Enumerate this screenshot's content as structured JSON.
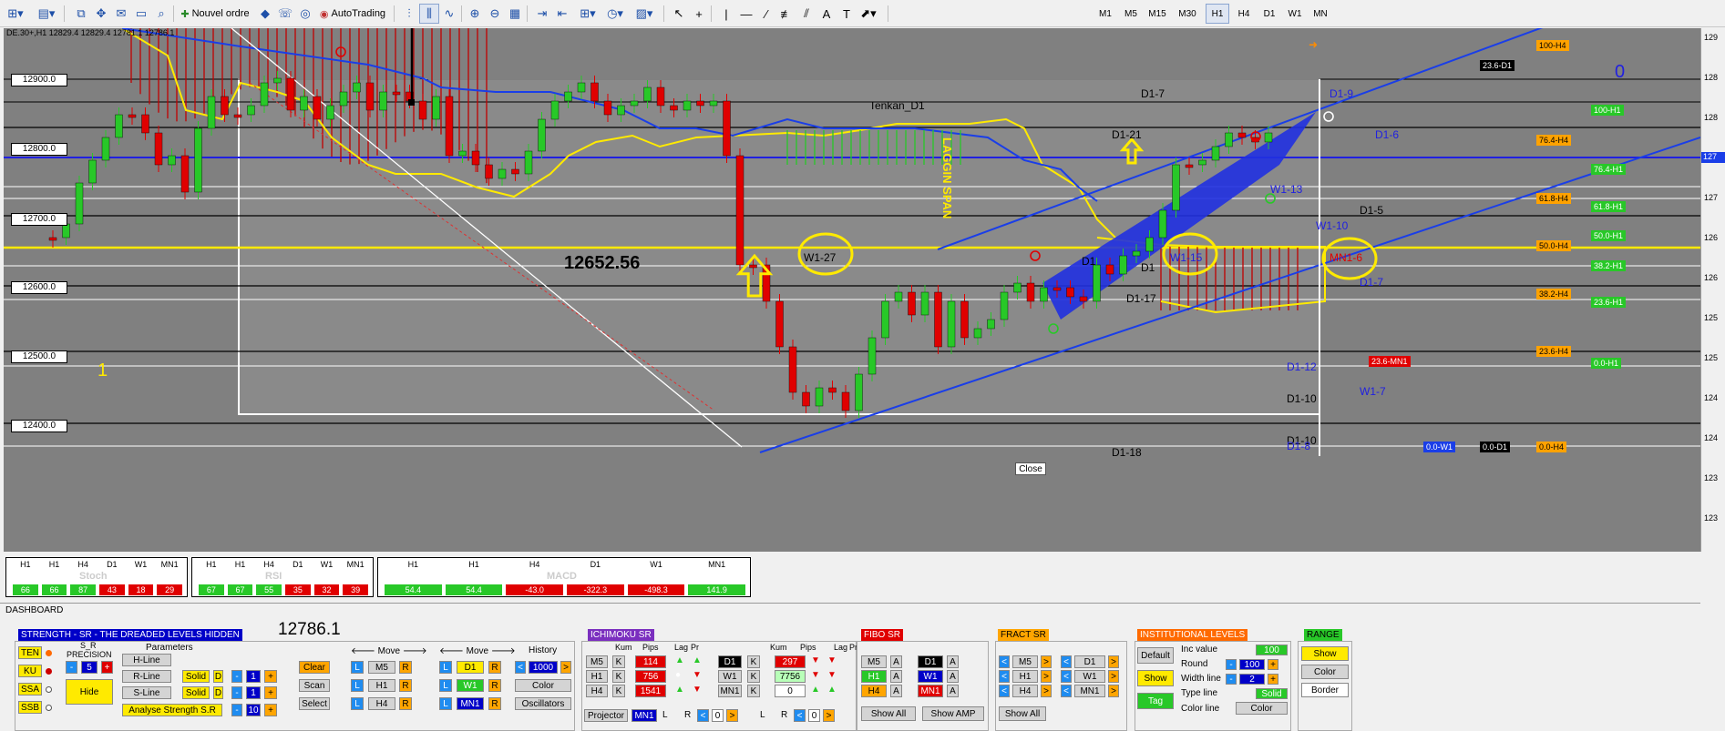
{
  "toolbar": {
    "new_order": "Nouvel ordre",
    "autotrading": "AutoTrading",
    "timeframes": [
      "M1",
      "M5",
      "M15",
      "M30",
      "H1",
      "H4",
      "D1",
      "W1",
      "MN"
    ],
    "active_timeframe": "H1"
  },
  "chart": {
    "symbol_info": "DE.30+,H1  12829.4 12829.4 12781.1 12786.1",
    "price_labels": [
      "12900.0",
      "12800.0",
      "12700.0",
      "12600.0",
      "12500.0",
      "12400.0"
    ],
    "right_ticks": [
      "129",
      "128",
      "128",
      "127",
      "127",
      "126",
      "126",
      "125",
      "125",
      "124",
      "124",
      "123",
      "123"
    ],
    "current_price_tag": "127",
    "annotations": {
      "big_price": "12652.56",
      "one_left": "1",
      "zero_right": "0",
      "tenkan": "Tenkan_D1",
      "lagging": "LAGGIN SPAN",
      "w1_27": "W1-27",
      "w1_15": "W1-15",
      "mn1_6": "MN1-6",
      "d1_7_top": "D1-7",
      "d1_9": "D1-9",
      "d1_6": "D1-6",
      "d1_21": "D1-21",
      "w1_13": "W1-13",
      "d1_5": "D1-5",
      "w1_10": "W1-10",
      "d1_1": "D1",
      "d1_1b": "D1",
      "d1_17": "D1-17",
      "d1_7b": "D1-7",
      "d1_12": "D1-12",
      "d1_10": "D1-10",
      "w1_7": "W1-7",
      "d1_18": "D1-18",
      "d1_10b": "D1-10",
      "d1_8": "D1-8"
    },
    "levels_right": [
      {
        "label": "100-H4",
        "color": "o"
      },
      {
        "label": "23.6-D1",
        "color": "k"
      },
      {
        "label": "100-H1",
        "color": "g"
      },
      {
        "label": "76.4-H4",
        "color": "o"
      },
      {
        "label": "76.4-H1",
        "color": "g"
      },
      {
        "label": "61.8-H4",
        "color": "o"
      },
      {
        "label": "61.8-H1",
        "color": "g"
      },
      {
        "label": "50.0-H1",
        "color": "g"
      },
      {
        "label": "50.0-H4",
        "color": "o"
      },
      {
        "label": "38.2-H1",
        "color": "g"
      },
      {
        "label": "38.2-H4",
        "color": "o"
      },
      {
        "label": "23.6-H1",
        "color": "g"
      },
      {
        "label": "23.6-H4",
        "color": "o"
      },
      {
        "label": "23.6-MN1",
        "color": "r"
      },
      {
        "label": "0.0-H1",
        "color": "g"
      },
      {
        "label": "0.0-W1",
        "color": "b"
      },
      {
        "label": "0.0-D1",
        "color": "k"
      },
      {
        "label": "0.0-H4",
        "color": "o"
      }
    ],
    "close_button": "Close"
  },
  "indicators": {
    "stoch": {
      "name": "Stoch",
      "tfs": [
        "H1",
        "H1",
        "H4",
        "D1",
        "W1",
        "MN1"
      ],
      "values": [
        "66",
        "66",
        "87",
        "43",
        "18",
        "29"
      ],
      "colors": [
        "g",
        "g",
        "g",
        "r",
        "r",
        "r"
      ]
    },
    "rsi": {
      "name": "RSI",
      "tfs": [
        "H1",
        "H1",
        "H4",
        "D1",
        "W1",
        "MN1"
      ],
      "values": [
        "67",
        "67",
        "55",
        "35",
        "32",
        "39"
      ],
      "colors": [
        "g",
        "g",
        "g",
        "r",
        "r",
        "r"
      ]
    },
    "macd": {
      "name": "MACD",
      "tfs": [
        "H1",
        "H1",
        "H4",
        "D1",
        "W1",
        "MN1"
      ],
      "values": [
        "54.4",
        "54.4",
        "-43.0",
        "-322.3",
        "-498.3",
        "141.9"
      ],
      "colors": [
        "g",
        "g",
        "r",
        "r",
        "r",
        "g"
      ]
    }
  },
  "dashboard": {
    "title": "DASHBOARD",
    "strength": {
      "header": "STRENGTH - SR - THE DREADED LEVELS HIDDEN",
      "price": "12786.1",
      "lines": [
        "TEN",
        "KU",
        "SSA",
        "SSB"
      ],
      "sr_label": "S_R",
      "precision_label": "PRECISION",
      "precision_value": "5",
      "hide": "Hide",
      "parameters": "Parameters",
      "hline": "H-Line",
      "rline": "R-Line",
      "sline": "S-Line",
      "solid": "Solid",
      "d": "D",
      "one": "1",
      "analyse": "Analyse Strength S.R",
      "analyse_value": "10",
      "minus": "-",
      "plus": "+",
      "clear": "Clear",
      "scan": "Scan",
      "select": "Select",
      "move": "Move",
      "history": "History",
      "history_value": "1000",
      "color": "Color",
      "oscillators": "Oscillators",
      "tf_left": [
        "M5",
        "H1",
        "H4"
      ],
      "tf_right": [
        "D1",
        "W1",
        "MN1"
      ],
      "l": "L",
      "r": "R"
    },
    "ichimoku": {
      "header": "ICHIMOKU SR",
      "cols": [
        "Kum",
        "Pips",
        "Lag",
        "Pr",
        "Kum",
        "Pips",
        "Lag",
        "Pr"
      ],
      "rows_left": [
        {
          "tf": "M5",
          "pips": "114"
        },
        {
          "tf": "H1",
          "pips": "756"
        },
        {
          "tf": "H4",
          "pips": "1541"
        }
      ],
      "rows_right": [
        {
          "tf": "D1",
          "pips": "297"
        },
        {
          "tf": "W1",
          "pips": "7756"
        },
        {
          "tf": "MN1",
          "pips": "0"
        }
      ],
      "k": "K",
      "projector": "Projector",
      "projector_tf": "MN1",
      "zero": "0"
    },
    "fibo": {
      "header": "FIBO SR",
      "tfs": [
        "M5",
        "D1",
        "H1",
        "W1",
        "H4",
        "MN1"
      ],
      "a": "A",
      "show_all": "Show All",
      "show_amp": "Show AMP"
    },
    "fract": {
      "header": "FRACT SR",
      "tfs_left": [
        "M5",
        "H1",
        "H4"
      ],
      "tfs_right": [
        "D1",
        "W1",
        "MN1"
      ],
      "show_all": "Show All"
    },
    "institutional": {
      "header": "INSTITUTIONAL LEVELS",
      "default": "Default",
      "show": "Show",
      "tag": "Tag",
      "inc_label": "Inc value",
      "inc_value": "100",
      "round_label": "Round",
      "round_value": "100",
      "width_label": "Width line",
      "width_value": "2",
      "type_label": "Type line",
      "type_value": "Solid",
      "color_label": "Color line",
      "color_value": "Color"
    },
    "range": {
      "header": "RANGE",
      "show": "Show",
      "color": "Color",
      "border": "Border"
    }
  }
}
